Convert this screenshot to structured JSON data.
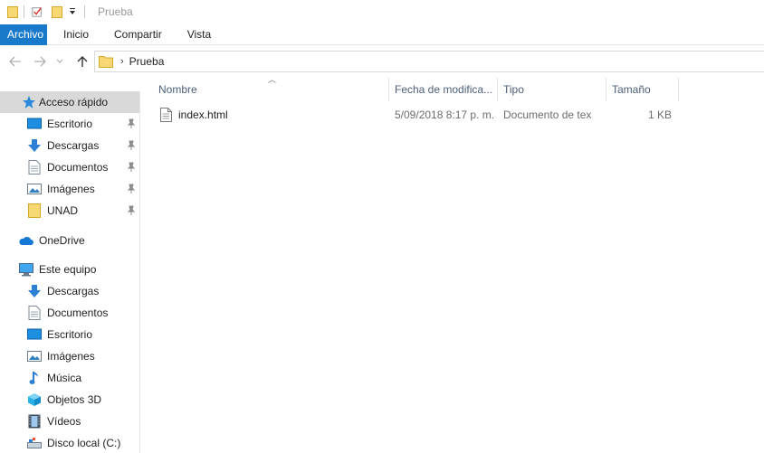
{
  "window": {
    "title": "Prueba"
  },
  "ribbon": {
    "tabs": [
      "Archivo",
      "Inicio",
      "Compartir",
      "Vista"
    ]
  },
  "address": {
    "path": "Prueba"
  },
  "sidebar": {
    "quick_access": {
      "label": "Acceso rápido",
      "items": [
        "Escritorio",
        "Descargas",
        "Documentos",
        "Imágenes",
        "UNAD"
      ]
    },
    "onedrive": "OneDrive",
    "this_pc": {
      "label": "Este equipo",
      "items": [
        "Descargas",
        "Documentos",
        "Escritorio",
        "Imágenes",
        "Música",
        "Objetos 3D",
        "Vídeos",
        "Disco local (C:)"
      ]
    }
  },
  "columns": {
    "name": "Nombre",
    "date": "Fecha de modifica...",
    "type": "Tipo",
    "size": "Tamaño"
  },
  "files": [
    {
      "name": "index.html",
      "date": "5/09/2018 8:17 p. m.",
      "type": "Documento de tex",
      "size": "1 KB"
    }
  ],
  "colors": {
    "accent": "#1979ca",
    "selected_nav": "#d9d9d9",
    "folder": "#f5d36b"
  }
}
